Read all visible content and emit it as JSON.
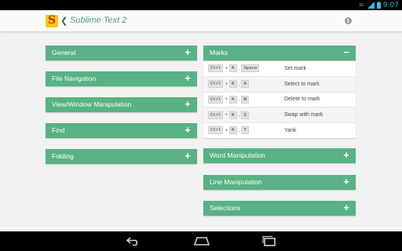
{
  "status_bar": {
    "time": "9:07",
    "signal_label": "3G"
  },
  "action_bar": {
    "title": "Sublime Text 2",
    "icons": {
      "app": "sublime-text-logo-icon",
      "up": "back-caret-icon",
      "info": "info-icon"
    }
  },
  "left_sections": [
    {
      "label": "General",
      "toggle": "+"
    },
    {
      "label": "File Navigation",
      "toggle": "+"
    },
    {
      "label": "View/Window Manipulation",
      "toggle": "+"
    },
    {
      "label": "Find",
      "toggle": "+"
    },
    {
      "label": "Folding",
      "toggle": "+"
    }
  ],
  "marks": {
    "label": "Marks",
    "toggle": "−",
    "shortcuts": [
      {
        "keys": [
          "Ctrl",
          "+",
          "K",
          ",",
          "Space"
        ],
        "description": "Set mark"
      },
      {
        "keys": [
          "Ctrl",
          "+",
          "K",
          ",",
          "A"
        ],
        "description": "Select to mark"
      },
      {
        "keys": [
          "Ctrl",
          "+",
          "K",
          ",",
          "W"
        ],
        "description": "Delete to mark"
      },
      {
        "keys": [
          "Ctrl",
          "+",
          "K",
          ",",
          "X"
        ],
        "description": "Swap with mark"
      },
      {
        "keys": [
          "Ctrl",
          "+",
          "K",
          ",",
          "Y"
        ],
        "description": "Yank"
      }
    ]
  },
  "right_sections": [
    {
      "label": "Word Manipulation",
      "toggle": "+"
    },
    {
      "label": "Line Manipulation",
      "toggle": "+"
    },
    {
      "label": "Selections",
      "toggle": "+"
    }
  ],
  "nav_bar": {
    "icons": [
      "back-icon",
      "home-icon",
      "recent-apps-icon"
    ]
  },
  "colors": {
    "accent": "#58b283",
    "title": "#4ea176",
    "status_icons": "#3fb3e3"
  }
}
